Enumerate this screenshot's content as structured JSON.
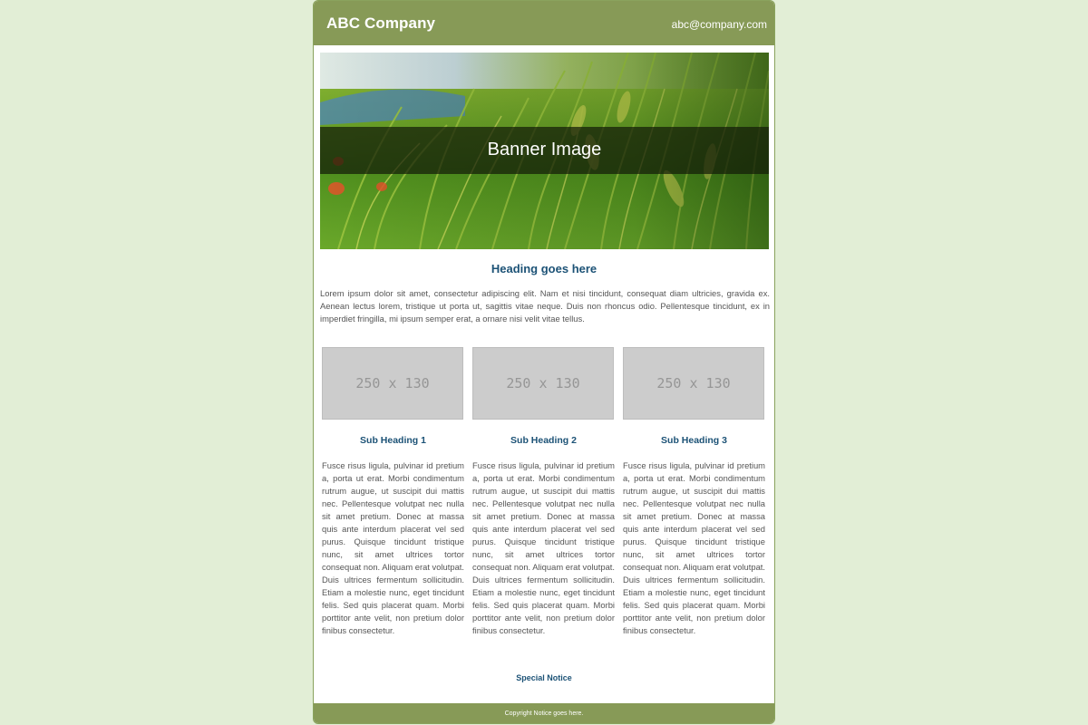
{
  "header": {
    "company": "ABC Company",
    "email": "abc@company.com"
  },
  "banner": {
    "text": "Banner Image"
  },
  "main": {
    "heading": "Heading goes here",
    "intro": "Lorem ipsum dolor sit amet, consectetur adipiscing elit. Nam et nisi tincidunt, consequat diam ultricies, gravida ex. Aenean lectus lorem, tristique ut porta ut, sagittis vitae neque. Duis non rhoncus odio. Pellentesque tincidunt, ex in imperdiet fringilla, mi ipsum semper erat, a ornare nisi velit vitae tellus."
  },
  "columns": [
    {
      "image_label": "250 x 130",
      "subheading": "Sub Heading 1",
      "text": "Fusce risus ligula, pulvinar id pretium a, porta ut erat. Morbi condimentum rutrum augue, ut suscipit dui mattis nec. Pellentesque volutpat nec nulla sit amet pretium. Donec at massa quis ante interdum placerat vel sed purus. Quisque tincidunt tristique nunc, sit amet ultrices tortor consequat non. Aliquam erat volutpat. Duis ultrices fermentum sollicitudin. Etiam a molestie nunc, eget tincidunt felis. Sed quis placerat quam. Morbi porttitor ante velit, non pretium dolor finibus consectetur."
    },
    {
      "image_label": "250 x 130",
      "subheading": "Sub Heading 2",
      "text": "Fusce risus ligula, pulvinar id pretium a, porta ut erat. Morbi condimentum rutrum augue, ut suscipit dui mattis nec. Pellentesque volutpat nec nulla sit amet pretium. Donec at massa quis ante interdum placerat vel sed purus. Quisque tincidunt tristique nunc, sit amet ultrices tortor consequat non. Aliquam erat volutpat. Duis ultrices fermentum sollicitudin. Etiam a molestie nunc, eget tincidunt felis. Sed quis placerat quam. Morbi porttitor ante velit, non pretium dolor finibus consectetur."
    },
    {
      "image_label": "250 x 130",
      "subheading": "Sub Heading 3",
      "text": "Fusce risus ligula, pulvinar id pretium a, porta ut erat. Morbi condimentum rutrum augue, ut suscipit dui mattis nec. Pellentesque volutpat nec nulla sit amet pretium. Donec at massa quis ante interdum placerat vel sed purus. Quisque tincidunt tristique nunc, sit amet ultrices tortor consequat non. Aliquam erat volutpat. Duis ultrices fermentum sollicitudin. Etiam a molestie nunc, eget tincidunt felis. Sed quis placerat quam. Morbi porttitor ante velit, non pretium dolor finibus consectetur."
    }
  ],
  "notice": {
    "text": "Special Notice"
  },
  "footer": {
    "copyright": "Copyright Notice goes here."
  },
  "colors": {
    "page_background": "#e2eed6",
    "brand_green": "#879a57",
    "heading_blue": "#1c5276",
    "body_text": "#555555",
    "placeholder_gray": "#cccccc"
  }
}
